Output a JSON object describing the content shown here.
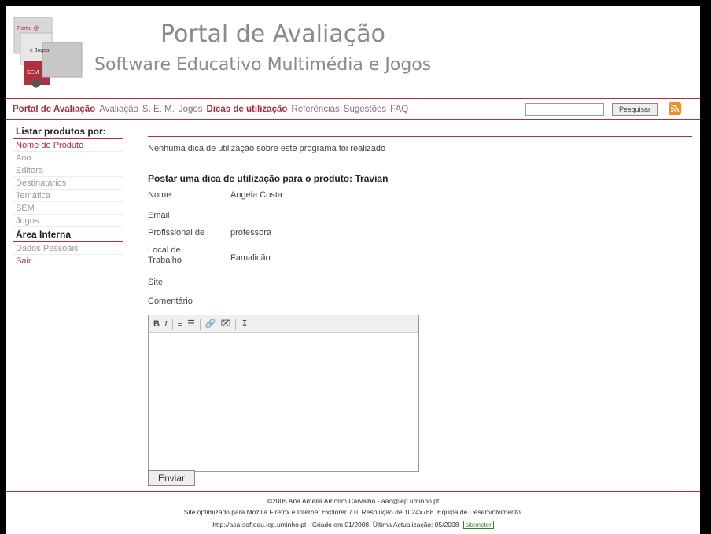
{
  "header": {
    "title": "Portal de Avaliação",
    "subtitle": "Software Educativo Multimédia e Jogos",
    "logo_text": [
      "Portal @",
      "e Jogos",
      "SEM"
    ]
  },
  "nav": {
    "items": [
      {
        "label": "Portal de Avaliação",
        "style": "bold"
      },
      {
        "label": "Avaliação",
        "style": "light"
      },
      {
        "label": "S. E. M.",
        "style": "light"
      },
      {
        "label": "Jogos",
        "style": "light"
      },
      {
        "label": "Dicas de utilização",
        "style": "bold"
      },
      {
        "label": "Referências",
        "style": "light"
      },
      {
        "label": "Sugestões",
        "style": "light"
      },
      {
        "label": "FAQ",
        "style": "light"
      }
    ],
    "search_value": "",
    "search_button": "Pesquisar",
    "rss_icon": "rss-icon",
    "colors": {
      "accent": "#b03040",
      "rss": "#f28c28"
    }
  },
  "sidebar": {
    "heading": "Listar produtos por:",
    "list": [
      "Nome do Produto",
      "Ano",
      "Editora",
      "Destinatários",
      "Temática",
      "SEM",
      "Jogos"
    ],
    "area_heading": "Área Interna",
    "area_items": [
      "Dados Pessoais",
      "Sair"
    ]
  },
  "main": {
    "message": "Nenhuma dica de utilização sobre este programa foi realizado",
    "post_title": "Postar uma dica de utilização para o produto: Travian",
    "fields": [
      {
        "label": "Nome",
        "value": "Angela Costa"
      },
      {
        "label": "Email",
        "value": ""
      },
      {
        "label": "Profissional de",
        "value": "professora"
      },
      {
        "label": "Local de Trabalho",
        "value": "Famalicão"
      },
      {
        "label": "Site",
        "value": ""
      },
      {
        "label": "Comentário",
        "value": ""
      }
    ],
    "toolbar": [
      "B",
      "I",
      "≡",
      "☰",
      "🔗",
      "⌧",
      "↧"
    ],
    "submit": "Enviar"
  },
  "footer": {
    "line1": "©2005 Ana Amélia Amorim Carvalho - aac@iep.uminho.pt",
    "line2": "Site optimizado para Mozilla Firefox e Internet Explorer 7.0. Resolução de 1024x768. Equipa de Desenvolvimento.",
    "line3": "http://aca-softedu.iep.uminho.pt - Criado em 01/2008. Última Actualização: 05/2008",
    "sitemeter": "sitemeter"
  }
}
